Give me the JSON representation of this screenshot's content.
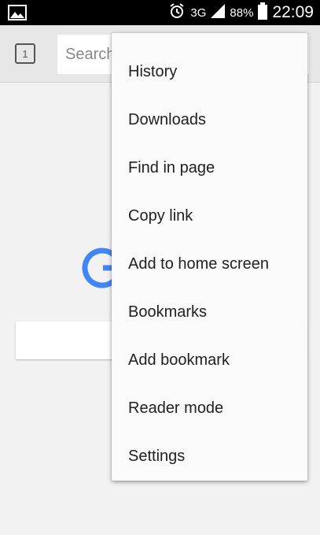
{
  "status_bar": {
    "network": "3G",
    "battery": "88%",
    "time": "22:09"
  },
  "toolbar": {
    "tab_count": "1",
    "search_placeholder": "Search"
  },
  "menu": {
    "items": [
      {
        "label": "History"
      },
      {
        "label": "Downloads"
      },
      {
        "label": "Find in page"
      },
      {
        "label": "Copy link"
      },
      {
        "label": "Add to home screen"
      },
      {
        "label": "Bookmarks"
      },
      {
        "label": "Add bookmark"
      },
      {
        "label": "Reader mode"
      },
      {
        "label": "Settings"
      }
    ]
  },
  "colors": {
    "google_blue": "#4285f4",
    "menu_bg": "#fafafa"
  }
}
